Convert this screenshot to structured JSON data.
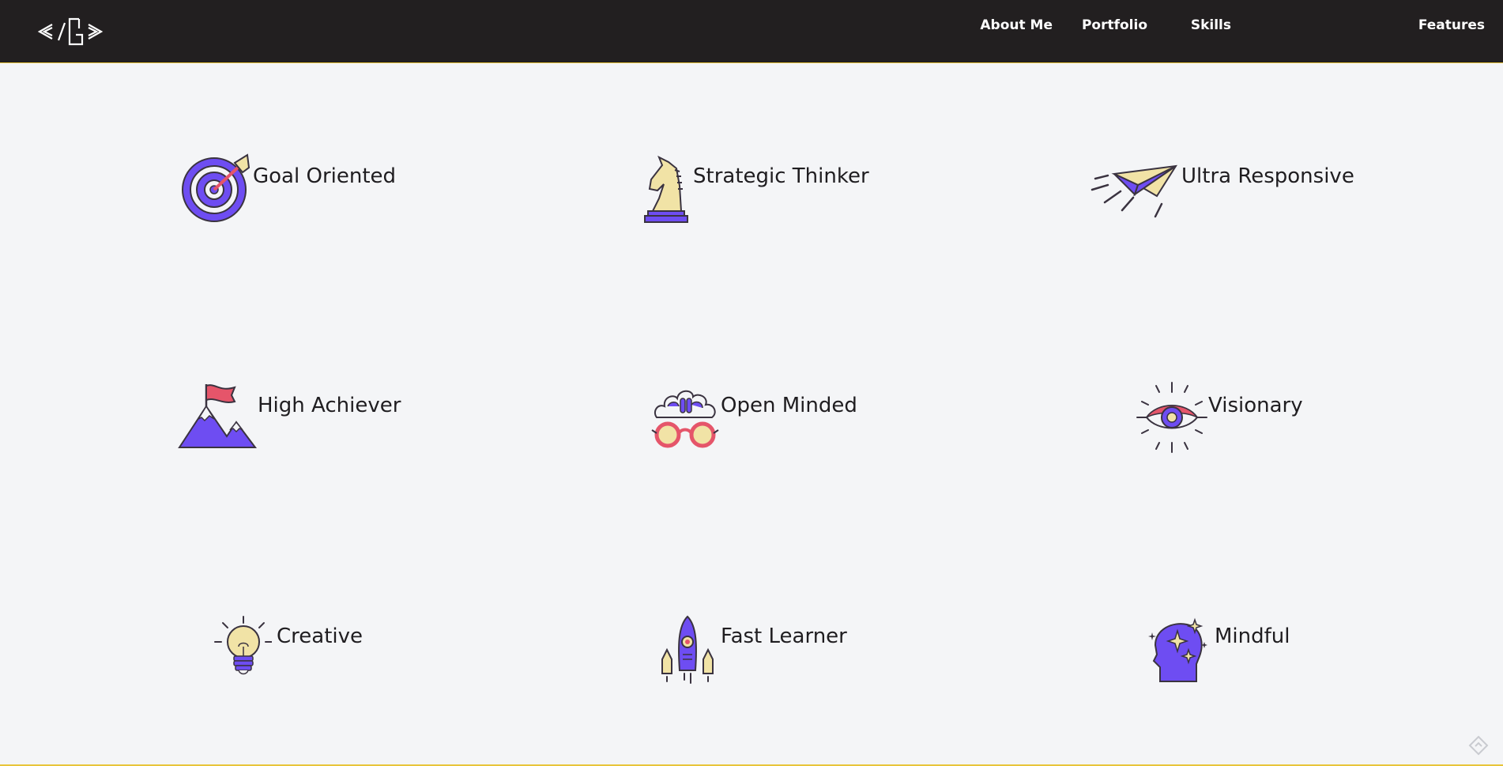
{
  "header": {
    "logo_text": "</G>",
    "nav": [
      {
        "label": "About Me"
      },
      {
        "label": "Portfolio"
      },
      {
        "label": "Skills"
      },
      {
        "label": "Features"
      }
    ]
  },
  "features": [
    {
      "label": "Goal Oriented",
      "icon": "target-icon"
    },
    {
      "label": "Strategic Thinker",
      "icon": "chess-knight-icon"
    },
    {
      "label": "Ultra Responsive",
      "icon": "paper-plane-icon"
    },
    {
      "label": "High Achiever",
      "icon": "mountain-flag-icon"
    },
    {
      "label": "Open Minded",
      "icon": "brain-glasses-icon"
    },
    {
      "label": "Visionary",
      "icon": "eye-icon"
    },
    {
      "label": "Creative",
      "icon": "lightbulb-icon"
    },
    {
      "label": "Fast Learner",
      "icon": "rocket-icon"
    },
    {
      "label": "Mindful",
      "icon": "head-sparkle-icon"
    }
  ],
  "colors": {
    "header_bg": "#221f20",
    "accent_yellow": "#e8c53a",
    "purple": "#6e4df2",
    "cream": "#f1e3a6",
    "pink": "#e5556a",
    "page_bg": "#f4f5f7",
    "text": "#1f1d20"
  }
}
